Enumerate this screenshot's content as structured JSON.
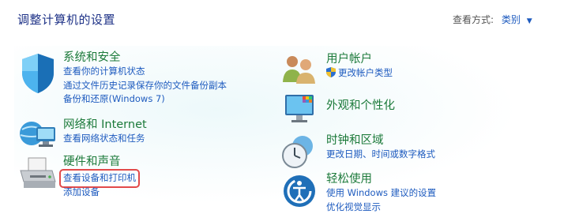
{
  "header": {
    "title": "调整计算机的设置",
    "view_by_label": "查看方式:",
    "view_by_value": "类别"
  },
  "left": {
    "system_security": {
      "heading": "系统和安全",
      "links": [
        "查看你的计算机状态",
        "通过文件历史记录保存你的文件备份副本",
        "备份和还原(Windows 7)"
      ]
    },
    "network": {
      "heading": "网络和 Internet",
      "links": [
        "查看网络状态和任务"
      ]
    },
    "hardware": {
      "heading": "硬件和声音",
      "links": [
        "查看设备和打印机",
        "添加设备"
      ]
    }
  },
  "right": {
    "user_accounts": {
      "heading": "用户帐户",
      "links": [
        "更改帐户类型"
      ]
    },
    "appearance": {
      "heading": "外观和个性化"
    },
    "clock_region": {
      "heading": "时钟和区域",
      "links": [
        "更改日期、时间或数字格式"
      ]
    },
    "ease_access": {
      "heading": "轻松使用",
      "links": [
        "使用 Windows 建议的设置",
        "优化视觉显示"
      ]
    }
  },
  "colors": {
    "heading": "#1c7a3a",
    "link": "#1e5bbf",
    "highlight": "#e24a4a"
  }
}
